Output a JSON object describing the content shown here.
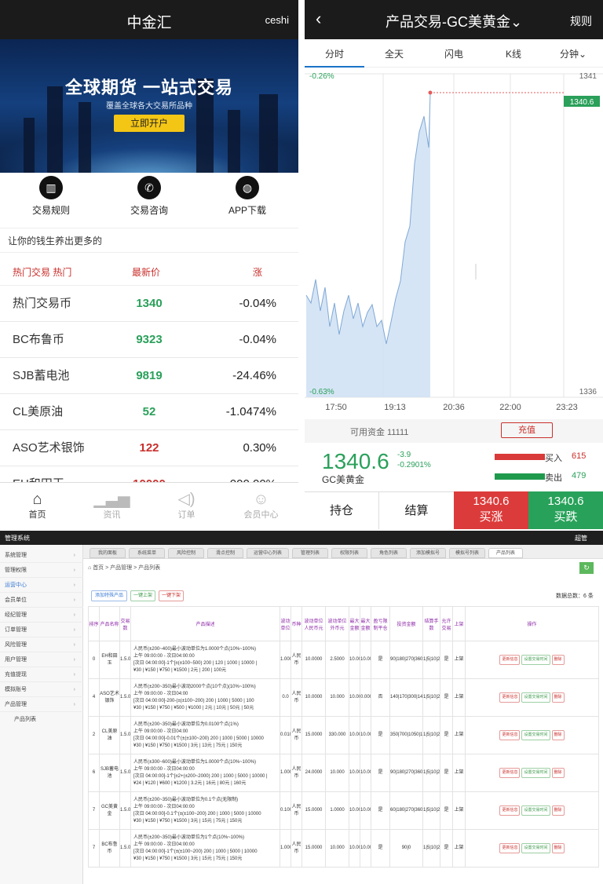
{
  "left": {
    "title": "中金汇",
    "user": "ceshi",
    "banner": {
      "headline": "全球期货 一站式交易",
      "sub": "覆盖全球各大交易所品种",
      "button": "立即开户"
    },
    "quick": [
      {
        "icon": "chart-icon",
        "label": "交易规则"
      },
      {
        "icon": "phone-icon",
        "label": "交易咨询"
      },
      {
        "icon": "wechat-icon",
        "label": "APP下载"
      }
    ],
    "promo": "让你的钱生养出更多的",
    "table_head": {
      "name": "热门交易  热门",
      "price": "最新价",
      "change": "涨"
    },
    "rows": [
      {
        "name": "热门交易币",
        "price": "1340",
        "change": "-0.04%",
        "color": "#2aa05a"
      },
      {
        "name": "BC布鲁币",
        "price": "9323",
        "change": "-0.04%",
        "color": "#2aa05a"
      },
      {
        "name": "SJB蓄电池",
        "price": "9819",
        "change": "-24.46%",
        "color": "#2aa05a"
      },
      {
        "name": "CL美原油",
        "price": "52",
        "change": "-1.0474%",
        "color": "#2aa05a"
      },
      {
        "name": "ASO艺术银饰",
        "price": "122",
        "change": "0.30%",
        "color": "#c9302c"
      },
      {
        "name": "EH和田玉",
        "price": "10000",
        "change": "000.00%",
        "color": "#c9302c"
      }
    ],
    "nav": [
      {
        "icon": "home-icon",
        "label": "首页"
      },
      {
        "icon": "market-icon",
        "label": "资讯"
      },
      {
        "icon": "speaker-icon",
        "label": "订单"
      },
      {
        "icon": "user-icon",
        "label": "会员中心"
      }
    ]
  },
  "right": {
    "title": "产品交易-GC美黄金",
    "rule": "规则",
    "back": "‹",
    "tabs": [
      "分时",
      "全天",
      "闪电",
      "K线",
      "分钟"
    ],
    "y_labels": {
      "top_left": "-0.26%",
      "top_right": "1341",
      "bottom_left": "-0.63%",
      "bottom_right": "1336",
      "marker": "1340.6"
    },
    "x_labels": [
      "17:50",
      "19:13",
      "20:36",
      "22:00",
      "23:23"
    ],
    "fund_label": "可用资金 11111",
    "charge": "充值",
    "price": "1340.6",
    "change": "-3.9",
    "change_pct": "-0.2901%",
    "product": "GC美黄金",
    "buy_label": "买入",
    "buy_value": "615",
    "sell_label": "卖出",
    "sell_value": "479",
    "bottom": [
      {
        "label": "持仓"
      },
      {
        "label": "结算"
      },
      {
        "top": "1340.6",
        "label": "买涨"
      },
      {
        "top": "1340.6",
        "label": "买跌"
      }
    ]
  },
  "admin": {
    "title": "管理系统",
    "user": "超管",
    "sidebar": [
      "系统管理",
      "管理权限",
      "运营中心",
      "会员单位",
      "经纪管理",
      "订单管理",
      "风险管理",
      "用户管理",
      "充值提现",
      "模拟账号",
      "产品管理",
      "产品列表"
    ],
    "tabs": [
      "我的面板",
      "系统菜单",
      "风险控制",
      "滑点控制",
      "运营中心列表",
      "管理列表",
      "权限列表",
      "角色列表",
      "添加模拟号",
      "模拟号列表",
      "产品列表"
    ],
    "breadcrumb": "首页 >  产品管理 >  产品列表",
    "buttons": [
      "添加特殊产品",
      "一键上架",
      "一键下架"
    ],
    "total": "数据总数：6 条",
    "columns": [
      "排序",
      "产品名称",
      "交易数",
      "产品描述",
      "波动单位",
      "币种",
      "波动单位人民币元",
      "波动单位外币元",
      "最大金额",
      "最大金额",
      "盈亏限制平仓",
      "投资金额",
      "结算手数",
      "允许交易",
      "上架",
      "操作"
    ],
    "rows": [
      {
        "sort": "0",
        "name": "EH和田玉",
        "num": "1.5.0",
        "desc": "人民币(±200~400)最小波动单位为1.0000个点(10%~100%)\n上午 09:00:00 - 次日04:00:00\n[次日 04:00:00]-1个[±(±100~500) 200 | 120 | 1000 | 10000 |\n¥30 | ¥150 | ¥750 | ¥1500 | 2元 | 200 | 100元",
        "unit": "1.000",
        "cur": "人民币",
        "rmb": "10.0000",
        "fx": "2.5000",
        "max1": "10.000",
        "max2": "10.000",
        "limit": "是",
        "invest": "90|180|270|360|900|1800",
        "lots": "1|5|10|20|25",
        "allow": "是",
        "shelf": "上架"
      },
      {
        "sort": "4",
        "name": "ASO艺术银饰",
        "num": "1.5.0",
        "desc": "人民币(±200~350)最小波动2000个点(10个点)(10%~100%)\n上午 09:00:00 - 次日04:00\n[次日 04:00:00]-200-(±(±100~200) 200 | 1000 | 5000 | 100\n¥30 | ¥150 | ¥750 | ¥500 | ¥1000 | 2元 | 10元 | 50元 | 50元",
        "unit": "0.0",
        "cur": "人民币",
        "rmb": "10.0000",
        "fx": "10.000",
        "max1": "10.000",
        "max2": "0.000",
        "limit": "否",
        "invest": "140|170|300|1400",
        "lots": "1|5|10|20|25",
        "allow": "是",
        "shelf": "上架"
      },
      {
        "sort": "2",
        "name": "CL美原油",
        "num": "1.5.0",
        "desc": "人民币(±200~350)最小波动单位为0.0100个点(1%)\n上午 09:00:00 - 次日04:00\n[次日 04:00:00]-0.01个(±(±100~200) 200 | 1000 | 5000 | 10000\n¥30 | ¥150 | ¥750 | ¥1500 | 3元 | 13元 | 75元 | 150元",
        "unit": "0.010",
        "cur": "人民币",
        "rmb": "15.0000",
        "fx": "330.000",
        "max1": "10.000",
        "max2": "10.000",
        "limit": "是",
        "invest": "350|700|1050|1400",
        "lots": "1|5|10|20|25",
        "allow": "是",
        "shelf": "上架"
      },
      {
        "sort": "6",
        "name": "SJB蓄电池",
        "num": "1.5.0",
        "desc": "人民币(±300~600)最小波动单位为1.0000个点(10%~100%)\n上午 09:00:00 - 次日04:00:00\n[次日 04:00:00]-1个[±2+(±200~2000) 200 | 1000 | 5000 | 10000 |\n¥24 | ¥120 | ¥600 | ¥1200 | 3.2元 | 16元 | 80元 | 160元",
        "unit": "1.000",
        "cur": "人民币",
        "rmb": "24.0000",
        "fx": "10.000",
        "max1": "10.000",
        "max2": "10.000",
        "limit": "是",
        "invest": "90|180|270|360|900|1800",
        "lots": "1|5|10|20|25",
        "allow": "是",
        "shelf": "上架"
      },
      {
        "sort": "7",
        "name": "GC美黄金",
        "num": "1.5.0",
        "desc": "人民币(±200~350)最小波动单位为0.1个点(无限制)\n上午 09:00:00 - 次日04:00:00\n[次日 04:00:00]-0.1个(±(±100~200) 200 | 1000 | 5000 | 10000\n¥30 | ¥150 | ¥750 | ¥1500 | 3元 | 15元 | 75元 | 150元",
        "unit": "0.100",
        "cur": "人民币",
        "rmb": "15.0000",
        "fx": "1.0000",
        "max1": "10.000",
        "max2": "10.000",
        "limit": "是",
        "invest": "60|180|270|360|900|1800",
        "lots": "1|5|10|20|25",
        "allow": "是",
        "shelf": "上架"
      },
      {
        "sort": "7",
        "name": "BC布鲁币",
        "num": "1.5.0",
        "desc": "人民币(±200~350)最小波动单位为1个点(10%~100%)\n上午 09:00:00 - 次日04:00:00\n[次日 04:00:00]-1个(±(±100~200) 200 | 1000 | 5000 | 10000\n¥30 | ¥150 | ¥750 | ¥1500 | 3元 | 15元 | 75元 | 150元",
        "unit": "1.000",
        "cur": "人民币",
        "rmb": "15.0000",
        "fx": "10.000",
        "max1": "10.000",
        "max2": "10.000",
        "limit": "是",
        "invest": "90|0",
        "lots": "1|5|10|20|25",
        "allow": "是",
        "shelf": "上架"
      }
    ],
    "actions": [
      "更新信息",
      "设置交易时间",
      "删除"
    ]
  },
  "colors": {
    "green": "#2aa05a",
    "red": "#c9302c",
    "dark": "#1b1b1b",
    "chart_fill": "#cfe0f3"
  }
}
